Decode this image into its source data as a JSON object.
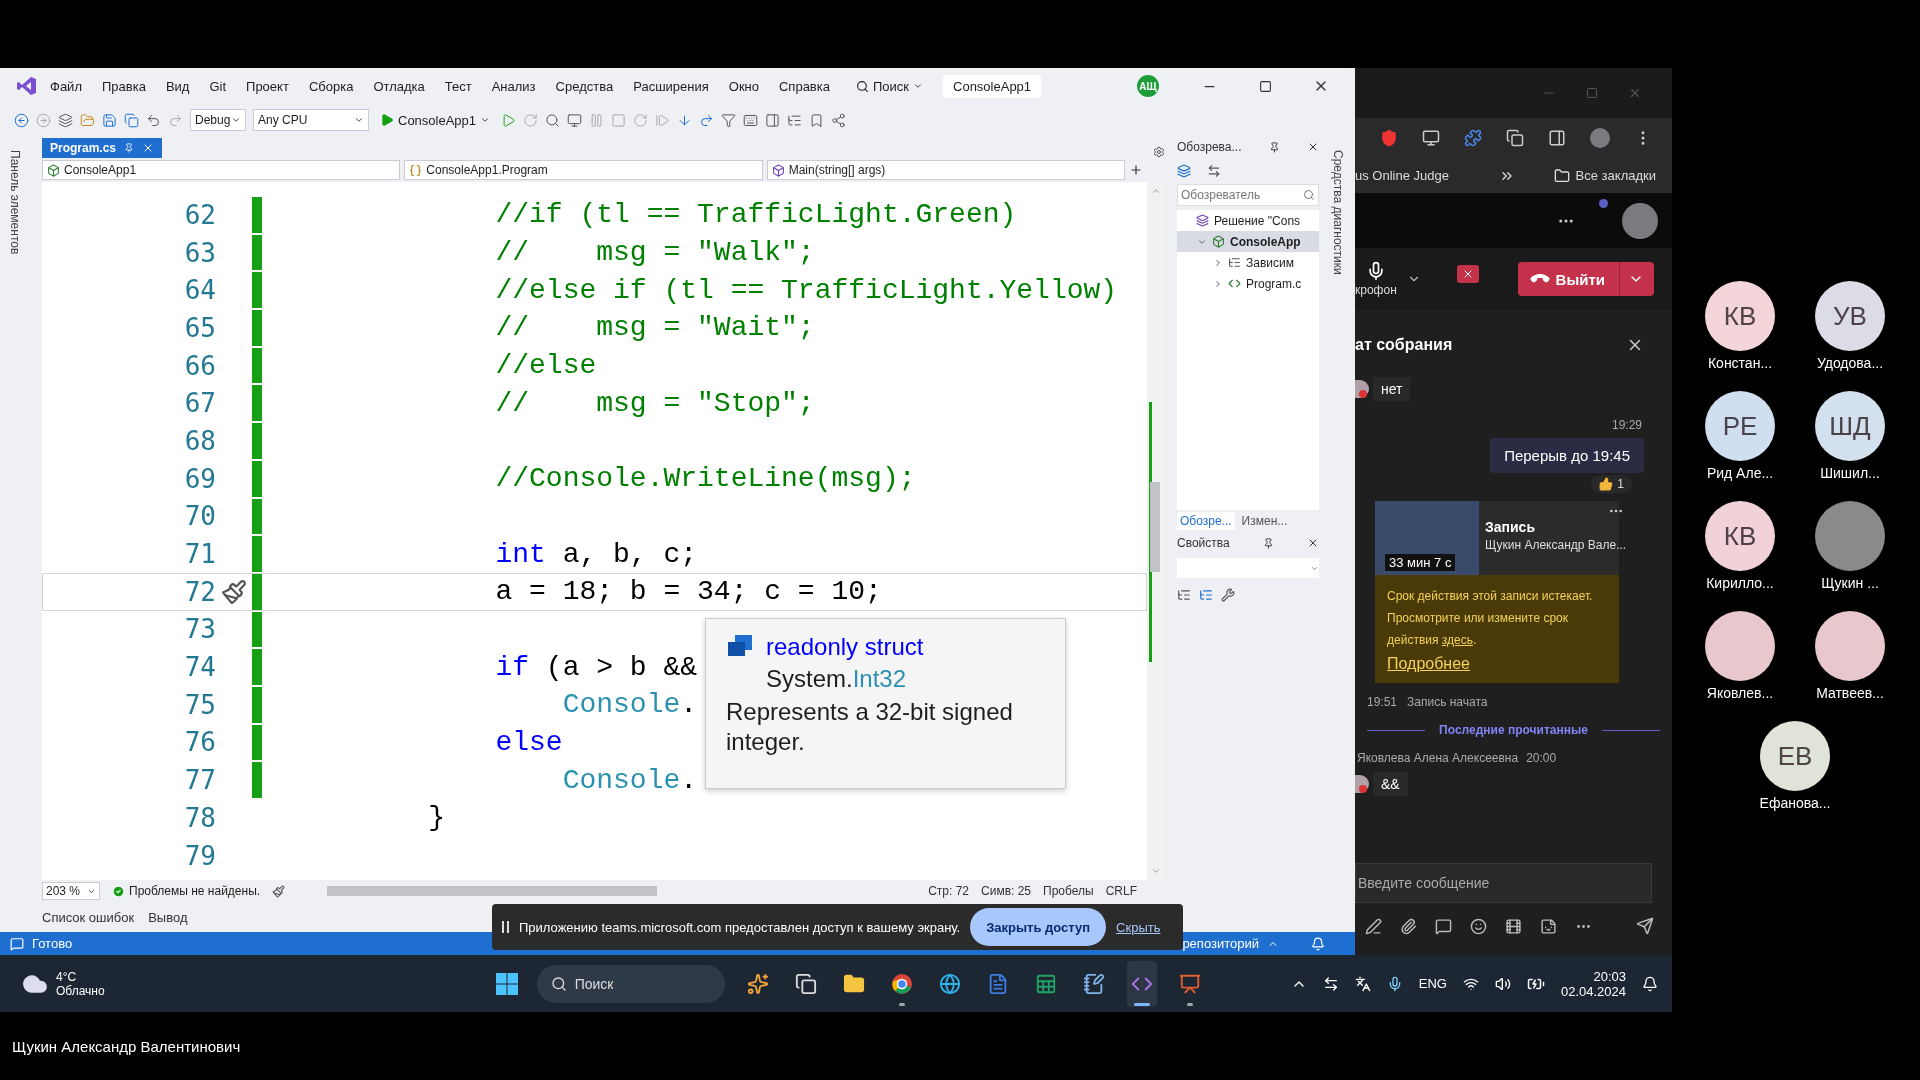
{
  "vs": {
    "menu": [
      "Файл",
      "Правка",
      "Вид",
      "Git",
      "Проект",
      "Сборка",
      "Отладка",
      "Тест",
      "Анализ",
      "Средства",
      "Расширения",
      "Окно",
      "Справка"
    ],
    "search": "Поиск",
    "title": "ConsoleApp1",
    "account": "АЩ",
    "toolbar": {
      "configuration": "Debug",
      "platform": "Any CPU",
      "start": "ConsoleApp1"
    },
    "toolbox_tab": "Панель элементов",
    "diagnostics_tab": "Средства диагностики",
    "document_tab": {
      "label": "Program.cs",
      "selected": true
    },
    "navigation": [
      {
        "kind": "project",
        "label": "ConsoleApp1"
      },
      {
        "kind": "class",
        "label": "ConsoleApp1.Program"
      },
      {
        "kind": "method",
        "label": "Main(string[] args)"
      }
    ],
    "lines": [
      {
        "number": "62",
        "changed": true,
        "current": false,
        "tokens": [
          {
            "kind": "comment",
            "text": "        //if (tl == TrafficLight.Green)"
          }
        ]
      },
      {
        "number": "63",
        "changed": true,
        "current": false,
        "tokens": [
          {
            "kind": "comment",
            "text": "        //    msg = \"Walk\";"
          }
        ]
      },
      {
        "number": "64",
        "changed": true,
        "current": false,
        "tokens": [
          {
            "kind": "comment",
            "text": "        //else if (tl == TrafficLight.Yellow)"
          }
        ]
      },
      {
        "number": "65",
        "changed": true,
        "current": false,
        "tokens": [
          {
            "kind": "comment",
            "text": "        //    msg = \"Wait\";"
          }
        ]
      },
      {
        "number": "66",
        "changed": true,
        "current": false,
        "tokens": [
          {
            "kind": "comment",
            "text": "        //else"
          }
        ]
      },
      {
        "number": "67",
        "changed": true,
        "current": false,
        "tokens": [
          {
            "kind": "comment",
            "text": "        //    msg = \"Stop\";"
          }
        ]
      },
      {
        "number": "68",
        "changed": true,
        "current": false
      },
      {
        "number": "69",
        "changed": true,
        "current": false,
        "tokens": [
          {
            "kind": "comment",
            "text": "        //Console.WriteLine(msg);"
          }
        ]
      },
      {
        "number": "70",
        "changed": true,
        "current": false
      },
      {
        "number": "71",
        "changed": true,
        "current": false,
        "tokens": [
          {
            "kind": "keyword",
            "text": "        int"
          },
          {
            "kind": "plain",
            "text": " a, b, c;"
          }
        ]
      },
      {
        "number": "72",
        "changed": true,
        "current": true,
        "tokens": [
          {
            "kind": "plain",
            "text": "        a = 18; b = 34; c = 10;"
          }
        ]
      },
      {
        "number": "73",
        "changed": true,
        "current": false
      },
      {
        "number": "74",
        "changed": true,
        "current": false,
        "tokens": [
          {
            "kind": "keyword",
            "text": "        if"
          },
          {
            "kind": "plain",
            "text": " (a > b &&"
          }
        ]
      },
      {
        "number": "75",
        "changed": true,
        "current": false,
        "tokens": [
          {
            "kind": "type",
            "text": "            Console"
          },
          {
            "kind": "plain",
            "text": "."
          }
        ]
      },
      {
        "number": "76",
        "changed": true,
        "current": false,
        "tokens": [
          {
            "kind": "keyword",
            "text": "        else"
          }
        ]
      },
      {
        "number": "77",
        "changed": true,
        "current": false,
        "tokens": [
          {
            "kind": "type",
            "text": "            Console"
          },
          {
            "kind": "plain",
            "text": "."
          }
        ]
      },
      {
        "number": "78",
        "changed": false,
        "current": false,
        "tokens": [
          {
            "kind": "plain",
            "text": "    }"
          }
        ]
      },
      {
        "number": "79",
        "changed": false,
        "current": false
      }
    ],
    "tooltip": {
      "keywords": "readonly struct",
      "namespace": "System.",
      "type": "Int32",
      "summary": "Represents a 32-bit signed integer."
    },
    "editor_status": {
      "zoom": "203 %",
      "issues": "Проблемы не найдены.",
      "line": "Стр: 72",
      "column": "Симв: 25",
      "whitespace": "Пробелы",
      "line_ending": "CRLF"
    },
    "tool_tabs": [
      "Список ошибок",
      "Вывод"
    ],
    "solution_explorer": {
      "title": "Обозрева...",
      "search_placeholder": "Обозреватель",
      "tree": [
        {
          "kind": "solution",
          "label": "Решение \"Cons",
          "selected": false,
          "children": [
            {
              "kind": "project",
              "label": "ConsoleApp",
              "selected": true,
              "expanded": true,
              "children": [
                {
                  "kind": "dependencies",
                  "label": "Зависим",
                  "selected": false,
                  "expanded": false
                },
                {
                  "kind": "csharp",
                  "label": "Program.c",
                  "selected": false,
                  "expanded": false
                }
              ]
            }
          ]
        }
      ],
      "tabs": [
        {
          "label": "Обозре...",
          "selected": true
        },
        {
          "label": "Измен...",
          "selected": false
        }
      ]
    },
    "properties": {
      "title": "Свойства"
    },
    "status_bar": {
      "state": "Готово",
      "repository": "репозиторий"
    }
  },
  "browser": {
    "bookmark": "us Online Judge",
    "all_bookmarks": "Все закладки"
  },
  "teams": {
    "mic_label": "крофон",
    "leave": "Выйти",
    "chat_title": "ат собрания",
    "messages": [
      {
        "kind": "incoming",
        "text": "нет"
      },
      {
        "kind": "time",
        "text": "19:29"
      },
      {
        "kind": "outgoing",
        "text": "Перерыв до 19:45",
        "reaction_count": "1"
      },
      {
        "kind": "recording",
        "duration": "33 мин 7 с",
        "title": "Запись",
        "author": "Щукин Александр Вале...",
        "warning": "Срок действия этой записи истекает. Просмотрите или измените срок действия",
        "warning_link": "здесь",
        "warning_end": ".",
        "more_link": "Подробнее"
      },
      {
        "kind": "event",
        "time": "19:51",
        "text": "Запись начата"
      },
      {
        "kind": "divider",
        "text": "Последние прочитанные"
      },
      {
        "kind": "sender",
        "name": "Яковлева Алена Алексеевна",
        "time": "20:00"
      },
      {
        "kind": "incoming",
        "text": "&&"
      }
    ],
    "input_placeholder": "Введите сообщение"
  },
  "share_notice": {
    "text": "Приложению teams.microsoft.com предоставлен доступ к вашему экрану.",
    "stop": "Закрыть доступ",
    "hide": "Скрыть"
  },
  "taskbar": {
    "temperature": "4°C",
    "weather": "Облачно",
    "search": "Поиск",
    "apps": [
      {
        "kind": "copilot",
        "running": false,
        "active": false
      },
      {
        "kind": "taskview",
        "running": false,
        "active": false
      },
      {
        "kind": "files",
        "running": false,
        "active": false
      },
      {
        "kind": "chrome",
        "running": true,
        "active": false
      },
      {
        "kind": "edge",
        "running": false,
        "active": false
      },
      {
        "kind": "word",
        "running": false,
        "active": false
      },
      {
        "kind": "excel",
        "running": false,
        "active": false
      },
      {
        "kind": "notepad",
        "running": false,
        "active": false
      },
      {
        "kind": "visualstudio",
        "running": true,
        "active": true
      },
      {
        "kind": "powerpoint",
        "running": true,
        "active": false
      }
    ],
    "language": "ENG",
    "time": "20:03",
    "date": "02.04.2024"
  },
  "participants": [
    {
      "kind": "initials",
      "initials": "КВ",
      "name": "Констан...",
      "color": "#f2d4d9"
    },
    {
      "kind": "initials",
      "initials": "УВ",
      "name": "Удодова...",
      "color": "#dcdce6"
    },
    {
      "kind": "initials",
      "initials": "РЕ",
      "name": "Рид Але...",
      "color": "#cfdff0"
    },
    {
      "kind": "initials",
      "initials": "ШД",
      "name": "Шишил...",
      "color": "#d3e0ee"
    },
    {
      "kind": "initials",
      "initials": "КВ",
      "name": "Кирилло...",
      "color": "#f0d2d8"
    },
    {
      "kind": "photo",
      "name": "Щукин ..."
    },
    {
      "kind": "drawing",
      "name": "Яковлев..."
    },
    {
      "kind": "drawing",
      "name": "Матвеев..."
    },
    {
      "kind": "initials",
      "initials": "ЕВ",
      "name": "Ефанова...",
      "color": "#dfe3d8"
    }
  ],
  "presenter": "Щукин Александр Валентинович"
}
